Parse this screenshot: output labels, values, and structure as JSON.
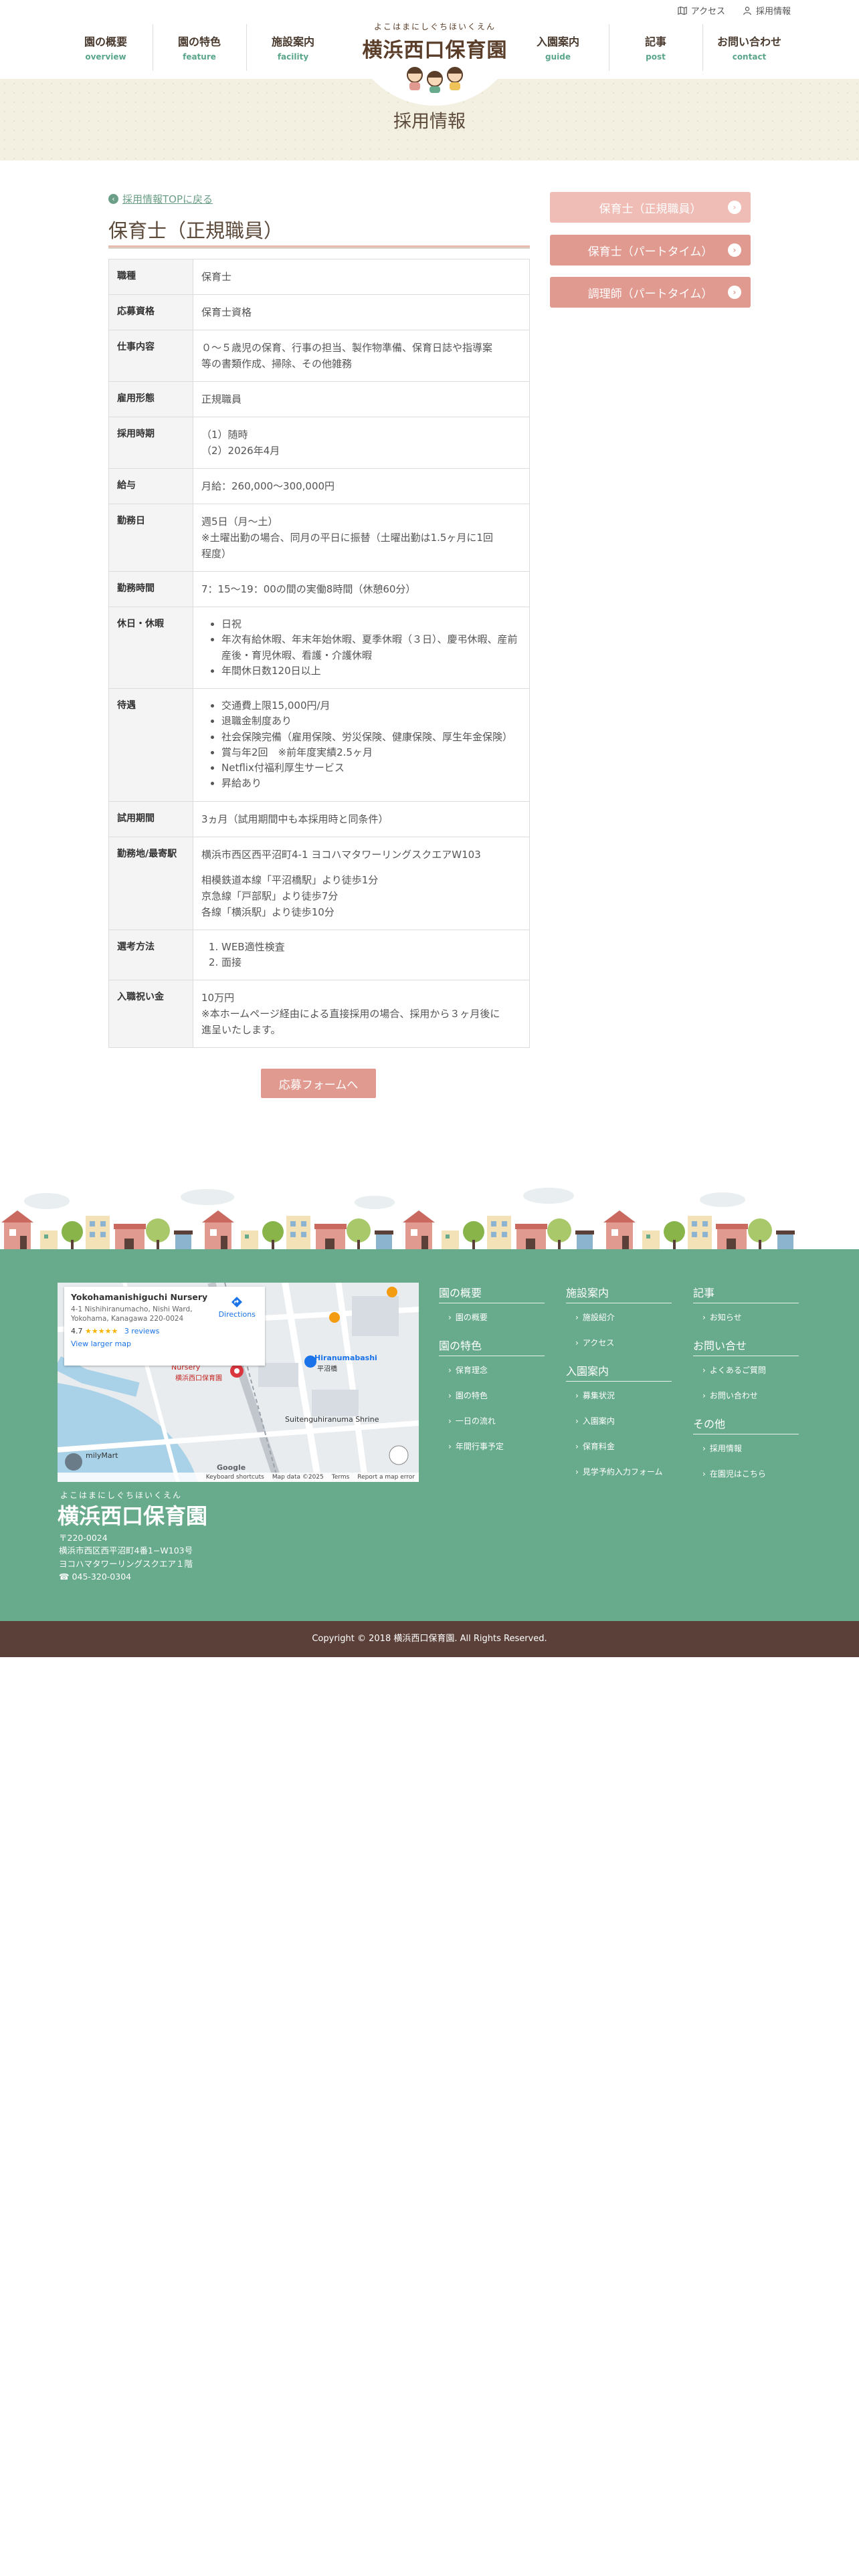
{
  "utility_links": [
    {
      "label": "アクセス",
      "icon": "map-icon"
    },
    {
      "label": "採用情報",
      "icon": "person-icon"
    }
  ],
  "nav": [
    {
      "label": "園の概要",
      "sub": "overview"
    },
    {
      "label": "園の特色",
      "sub": "feature"
    },
    {
      "label": "施設案内",
      "sub": "facility"
    },
    {
      "label": "入園案内",
      "sub": "guide"
    },
    {
      "label": "記事",
      "sub": "post"
    },
    {
      "label": "お問い合わせ",
      "sub": "contact"
    }
  ],
  "logo": {
    "kana": "よこはまにしぐちほいくえん",
    "name": "横浜西口保育園"
  },
  "page_title": "採用情報",
  "back_link": "採用情報TOPに戻る",
  "job_title": "保育士（正規職員）",
  "spec": {
    "rows": [
      {
        "label": "職種",
        "lines": [
          "保育士"
        ]
      },
      {
        "label": "応募資格",
        "lines": [
          "保育士資格"
        ]
      },
      {
        "label": "仕事内容",
        "lines": [
          "０～５歳児の保育、行事の担当、製作物準備、保育日誌や指導案",
          "等の書類作成、掃除、その他雑務"
        ]
      },
      {
        "label": "雇用形態",
        "lines": [
          "正規職員"
        ]
      },
      {
        "label": "採用時期",
        "lines": [
          "（1）随時",
          "（2）2026年4月"
        ]
      },
      {
        "label": "給与",
        "lines": [
          "月給：260,000〜300,000円"
        ]
      },
      {
        "label": "勤務日",
        "lines": [
          "週5日（月〜土）",
          "※土曜出勤の場合、同月の平日に振替（土曜出勤は1.5ヶ月に1回",
          "程度）"
        ]
      },
      {
        "label": "勤務時間",
        "lines": [
          "7：15〜19：00の間の実働8時間（休憩60分）"
        ]
      }
    ],
    "holiday_label": "休日・休暇",
    "holidays": [
      "日祝",
      "年次有給休暇、年末年始休暇、夏季休暇（３日）、慶弔休暇、産前産後・育児休暇、看護・介護休暇",
      "年間休日数120日以上"
    ],
    "welfare_label": "待遇",
    "welfare": [
      "交通費上限15,000円/月",
      "退職金制度あり",
      "社会保険完備（雇用保険、労災保険、健康保険、厚生年金保険）",
      "賞与年2回　※前年度実績2.5ヶ月",
      "Netflix付福利厚生サービス",
      "昇給あり"
    ],
    "trial_label": "試用期間",
    "trial": "3ヵ月（試用期間中も本採用時と同条件）",
    "location_label": "勤務地/最寄駅",
    "location_address": "横浜市西区西平沼町4-1 ヨコハマタワーリングスクエアW103",
    "location_stations": [
      "相模鉄道本線「平沼橋駅」より徒歩1分",
      "京急線「戸部駅」より徒歩7分",
      "各線「横浜駅」より徒歩10分"
    ],
    "selection_label": "選考方法",
    "selection": [
      "WEB適性検査",
      "面接"
    ],
    "bonus_label": "入職祝い金",
    "bonus_lines": [
      "10万円",
      "※本ホームページ経由による直接採用の場合、採用から３ヶ月後に",
      "進呈いたします。"
    ]
  },
  "apply_button": "応募フォームへ",
  "side_buttons": [
    {
      "label": "保育士（正規職員）",
      "color": "#efbdb6"
    },
    {
      "label": "保育士（パートタイム）",
      "color": "#e19a90"
    },
    {
      "label": "調理師（パートタイム）",
      "color": "#e19a90"
    }
  ],
  "map": {
    "place": "Yokohamanishiguchi Nursery",
    "address": "4-1 Nishihiranumacho, Nishi Ward, Yokohama, Kanagawa 220-0024",
    "rating": "4.7",
    "stars": "★★★★★",
    "reviews": "3 reviews",
    "directions": "Directions",
    "larger": "View larger map",
    "station_label": "Hiranumabashi",
    "station_label_jp": "平沼橋",
    "shrine_label": "Suitenguhiranuma Shrine",
    "pin_label": "Nursery",
    "pin_label_jp": "横浜西口保育園",
    "store_label": "milyMart",
    "attribution": [
      "Keyboard shortcuts",
      "Map data ©2025",
      "Terms",
      "Report a map error"
    ],
    "google": "Google"
  },
  "footer_address": [
    "〒220-0024",
    "横浜市西区西平沼町4番1−W103号",
    "ヨコハマタワーリングスクエア１階",
    "045-320-0304"
  ],
  "footer_menu": {
    "col1": [
      {
        "head": "園の概要",
        "links": [
          "園の概要"
        ]
      },
      {
        "head": "園の特色",
        "links": [
          "保育理念",
          "園の特色",
          "一日の流れ",
          "年間行事予定"
        ]
      }
    ],
    "col2": [
      {
        "head": "施設案内",
        "links": [
          "施設紹介",
          "アクセス"
        ]
      },
      {
        "head": "入園案内",
        "links": [
          "募集状況",
          "入園案内",
          "保育料金",
          "見学予約入力フォーム"
        ]
      }
    ],
    "col3": [
      {
        "head": "記事",
        "links": [
          "お知らせ"
        ]
      },
      {
        "head": "お問い合せ",
        "links": [
          "よくあるご質問",
          "お問い合わせ"
        ]
      },
      {
        "head": "その他",
        "links": [
          "採用情報",
          "在園児はこちら"
        ]
      }
    ]
  },
  "copyright": "Copyright © 2018 横浜西口保育園. All Rights Reserved."
}
